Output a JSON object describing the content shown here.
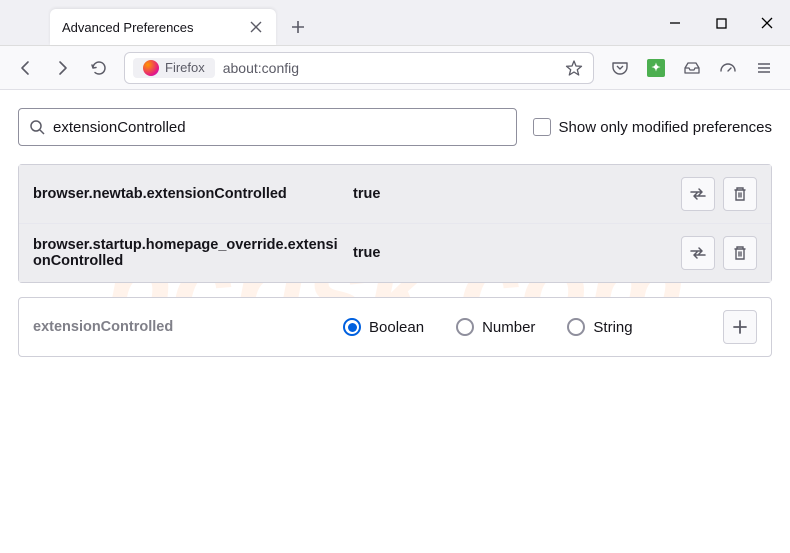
{
  "titlebar": {
    "tab_title": "Advanced Preferences"
  },
  "urlbar": {
    "identity_label": "Firefox",
    "url": "about:config"
  },
  "search": {
    "value": "extensionControlled",
    "checkbox_label": "Show only modified preferences"
  },
  "prefs": [
    {
      "name": "browser.newtab.extensionControlled",
      "value": "true"
    },
    {
      "name": "browser.startup.homepage_override.extensionControlled",
      "value": "true"
    }
  ],
  "add": {
    "name": "extensionControlled",
    "types": [
      "Boolean",
      "Number",
      "String"
    ],
    "selected": "Boolean"
  }
}
